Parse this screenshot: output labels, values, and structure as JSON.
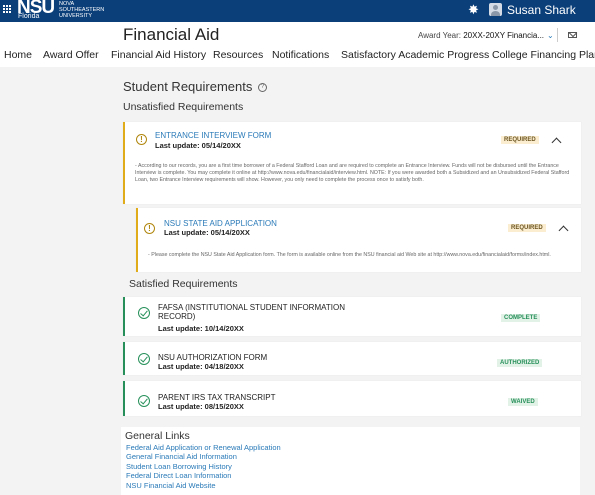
{
  "topbar": {
    "logo_mark": "NSU",
    "logo_sub": "Florida",
    "logo_name": "NOVA SOUTHEASTERN UNIVERSITY",
    "gear_glyph": "✸",
    "user_name": "Susan Shark"
  },
  "header": {
    "title": "Financial Aid",
    "award_year_label": "Award Year:",
    "award_year_value": "20XX-20XY Financia...",
    "nav": [
      "Home",
      "Award Offer",
      "Financial Aid History",
      "Resources",
      "Notifications",
      "Satisfactory Academic Progress",
      "College Financing Plan"
    ]
  },
  "student_requirements": {
    "heading": "Student Requirements",
    "help_glyph": "?",
    "unsatisfied_heading": "Unsatisfied Requirements",
    "unsatisfied": [
      {
        "icon_glyph": "!",
        "title": "ENTRANCE INTERVIEW FORM",
        "last_update": "Last update:  05/14/20XX",
        "status": "REQUIRED",
        "description": "- According to our records, you are a first time borrower of a Federal Stafford Loan and are required to complete an Entrance Interview. Funds will not be disbursed until the Entrance Interview is complete. You may complete it online at http://www.nova.edu/financialaid/interview.html. NOTE: If you were awarded both a Subsidized and an Unsubsidized Federal Stafford Loan, two Entrance Interview requirements will show. However, you only need to complete the process once to satisfy both."
      },
      {
        "icon_glyph": "!",
        "title": "NSU STATE AID APPLICATION",
        "last_update": "Last update:  05/14/20XX",
        "status": "REQUIRED",
        "description": "- Please complete the NSU State Aid Application form. The form is available online from the NSU financial aid Web site at http://www.nova.edu/financialaid/forms/index.html."
      }
    ],
    "satisfied_heading": "Satisfied Requirements",
    "satisfied": [
      {
        "title": "FAFSA (INSTITUTIONAL STUDENT INFORMATION RECORD)",
        "last_update": "Last update:  10/14/20XX",
        "status": "COMPLETE"
      },
      {
        "title": "NSU AUTHORIZATION FORM",
        "last_update": "Last update:  04/18/20XX",
        "status": "AUTHORIZED"
      },
      {
        "title": "PARENT IRS TAX TRANSCRIPT",
        "last_update": "Last update:  08/15/20XX",
        "status": "WAIVED"
      }
    ]
  },
  "general_links": {
    "heading": "General Links",
    "items": [
      "Federal Aid Application or Renewal Application",
      "General Financial Aid Information",
      "Student Loan Borrowing History",
      "Federal Direct Loan Information",
      "NSU Financial Aid Website"
    ]
  },
  "colors": {
    "topbar": "#0b3f7a",
    "link": "#2a7ab8",
    "unsatisfied_border": "#e0ac1a",
    "satisfied_border": "#27905a"
  }
}
